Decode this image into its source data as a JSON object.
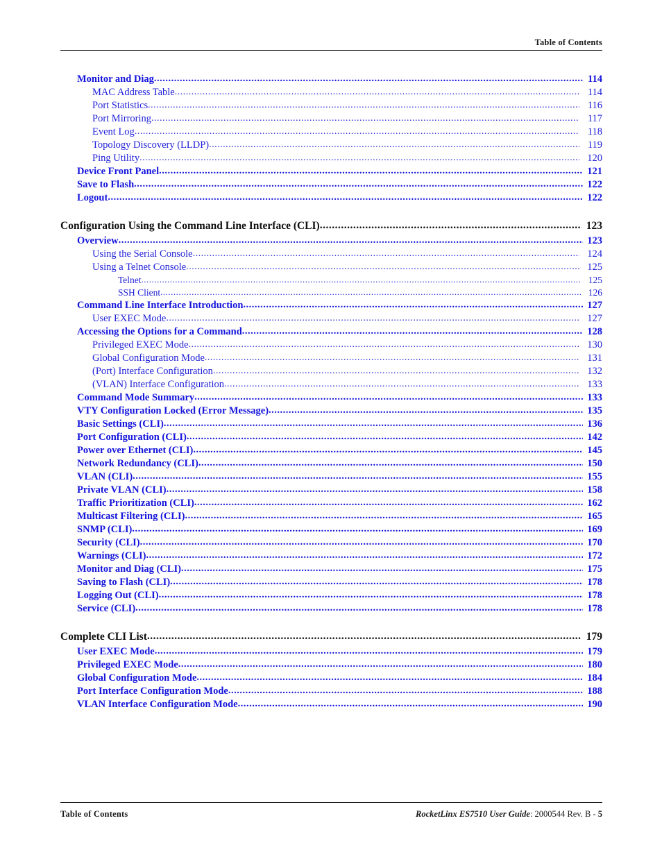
{
  "header": {
    "title": "Table of Contents"
  },
  "footer": {
    "left": "Table of Contents",
    "guide": "RocketLinx ES7510 User Guide",
    "doc_id": ": 2000544 Rev. B - ",
    "page_number": "5"
  },
  "colors": {
    "link_blue": "#1414dc",
    "text_black": "#101010"
  },
  "toc": {
    "groups": [
      {
        "entries": [
          {
            "level": 2,
            "label": "Monitor and Diag",
            "page": "114"
          },
          {
            "level": 3,
            "label": "MAC Address Table",
            "page": "114"
          },
          {
            "level": 3,
            "label": "Port Statistics",
            "page": "116"
          },
          {
            "level": 3,
            "label": "Port Mirroring",
            "page": "117"
          },
          {
            "level": 3,
            "label": "Event Log",
            "page": "118"
          },
          {
            "level": 3,
            "label": "Topology Discovery (LLDP)",
            "page": "119"
          },
          {
            "level": 3,
            "label": "Ping Utility",
            "page": "120"
          },
          {
            "level": 2,
            "label": "Device Front Panel",
            "page": "121"
          },
          {
            "level": 2,
            "label": "Save to Flash",
            "page": "122"
          },
          {
            "level": 2,
            "label": "Logout",
            "page": "122"
          }
        ]
      },
      {
        "entries": [
          {
            "level": 1,
            "label": "Configuration Using the Command Line Interface (CLI)",
            "page": "123"
          },
          {
            "level": 2,
            "label": "Overview",
            "page": "123"
          },
          {
            "level": 3,
            "label": "Using the Serial Console",
            "page": "124"
          },
          {
            "level": 3,
            "label": "Using a Telnet Console",
            "page": "125"
          },
          {
            "level": 4,
            "label": "Telnet",
            "page": "125"
          },
          {
            "level": 4,
            "label": "SSH Client",
            "page": "126"
          },
          {
            "level": 2,
            "label": "Command Line Interface Introduction",
            "page": "127"
          },
          {
            "level": 3,
            "label": "User EXEC Mode",
            "page": "127"
          },
          {
            "level": 2,
            "label": "Accessing the Options for a Command",
            "page": "128"
          },
          {
            "level": 3,
            "label": "Privileged EXEC Mode",
            "page": "130"
          },
          {
            "level": 3,
            "label": "Global Configuration Mode",
            "page": "131"
          },
          {
            "level": 3,
            "label": "(Port) Interface Configuration",
            "page": "132"
          },
          {
            "level": 3,
            "label": "(VLAN) Interface Configuration",
            "page": "133"
          },
          {
            "level": 2,
            "label": "Command Mode Summary",
            "page": "133"
          },
          {
            "level": 2,
            "label": "VTY Configuration Locked (Error Message)",
            "page": "135"
          },
          {
            "level": 2,
            "label": "Basic Settings (CLI)",
            "page": "136"
          },
          {
            "level": 2,
            "label": "Port Configuration (CLI)",
            "page": "142"
          },
          {
            "level": 2,
            "label": "Power over Ethernet (CLI)",
            "page": "145"
          },
          {
            "level": 2,
            "label": "Network Redundancy (CLI)",
            "page": "150"
          },
          {
            "level": 2,
            "label": "VLAN (CLI)",
            "page": "155"
          },
          {
            "level": 2,
            "label": "Private VLAN (CLI)",
            "page": "158"
          },
          {
            "level": 2,
            "label": "Traffic Prioritization (CLI)",
            "page": "162"
          },
          {
            "level": 2,
            "label": "Multicast Filtering (CLI)",
            "page": "165"
          },
          {
            "level": 2,
            "label": "SNMP (CLI)",
            "page": "169"
          },
          {
            "level": 2,
            "label": "Security (CLI)",
            "page": "170"
          },
          {
            "level": 2,
            "label": "Warnings (CLI)",
            "page": "172"
          },
          {
            "level": 2,
            "label": "Monitor and Diag (CLI)",
            "page": "175"
          },
          {
            "level": 2,
            "label": "Saving to Flash (CLI)",
            "page": "178"
          },
          {
            "level": 2,
            "label": "Logging Out (CLI)",
            "page": "178"
          },
          {
            "level": 2,
            "label": "Service (CLI)",
            "page": "178"
          }
        ]
      },
      {
        "entries": [
          {
            "level": 1,
            "label": "Complete CLI List",
            "page": "179"
          },
          {
            "level": 2,
            "label": "User EXEC Mode",
            "page": "179"
          },
          {
            "level": 2,
            "label": "Privileged EXEC Mode",
            "page": "180"
          },
          {
            "level": 2,
            "label": "Global Configuration Mode",
            "page": "184"
          },
          {
            "level": 2,
            "label": "Port Interface Configuration Mode",
            "page": "188"
          },
          {
            "level": 2,
            "label": "VLAN Interface Configuration Mode",
            "page": "190"
          }
        ]
      }
    ]
  }
}
